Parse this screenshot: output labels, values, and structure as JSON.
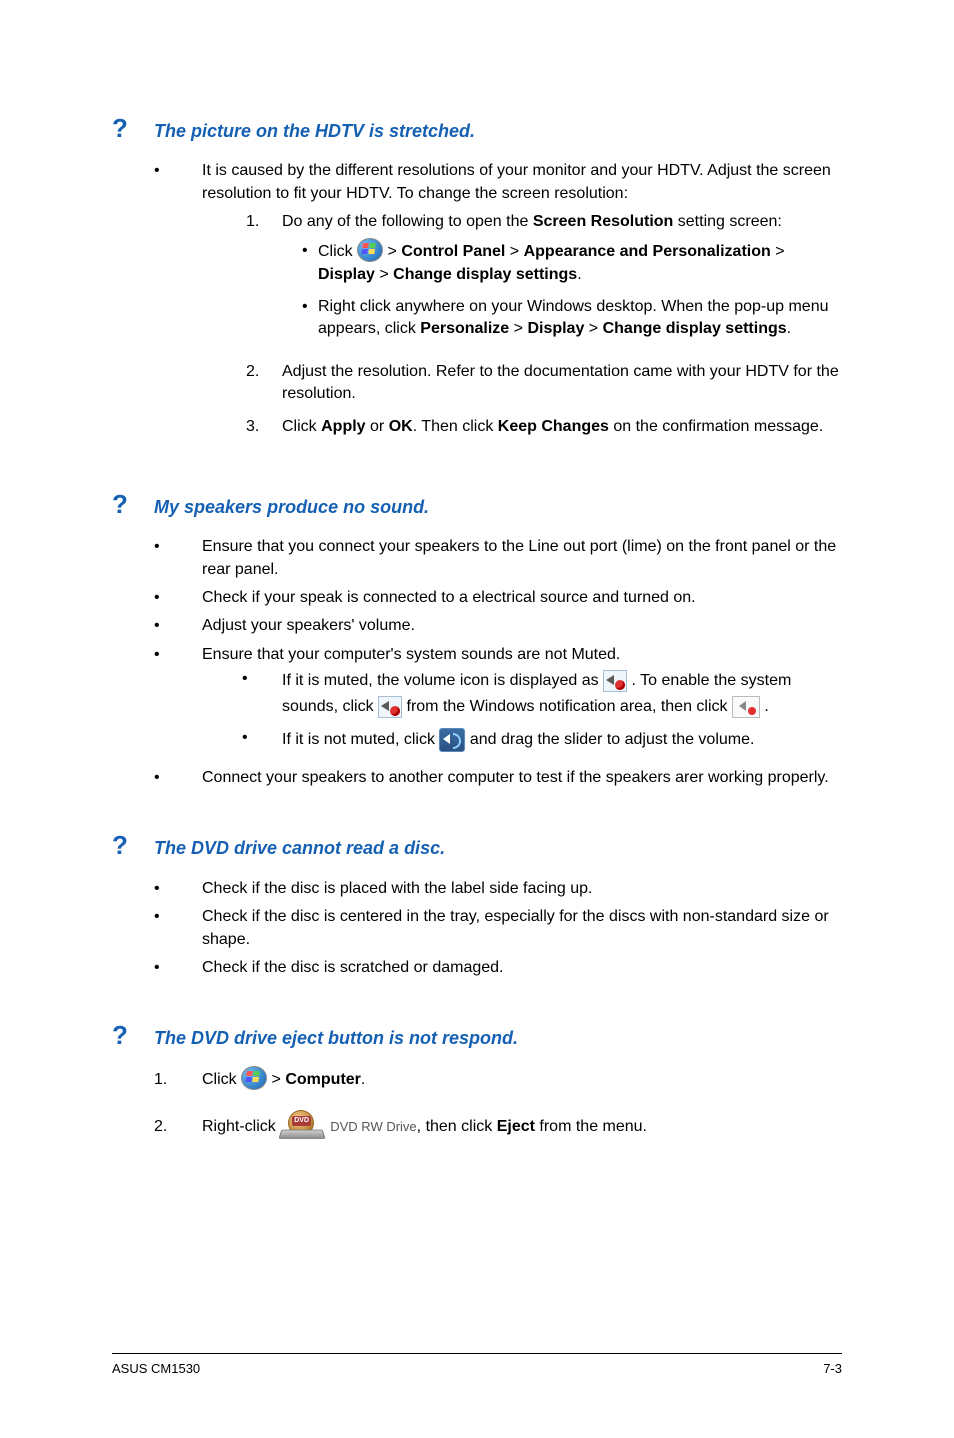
{
  "q1": {
    "title": "The picture on the HDTV is stretched.",
    "intro": "It is caused by the different resolutions of your monitor and your HDTV. Adjust the screen resolution to fit your HDTV. To change the screen resolution:",
    "step1": "Do any of the following to open the ",
    "step1_bold": "Screen Resolution",
    "step1_after": " setting screen:",
    "sub1_pre": "Click ",
    "sub1_mid": " > ",
    "sub1_cp": "Control Panel",
    "sub1_ap": "Appearance and Personalization",
    "sub1_disp": "Display",
    "sub1_cds": "Change display settings",
    "sub2_a": "Right click anywhere on your Windows desktop. When the pop-up menu appears, click ",
    "sub2_p": "Personalize",
    "sub2_d": "Display",
    "sub2_c": "Change display settings",
    "step2": "Adjust the resolution. Refer to the documentation came with your HDTV for the resolution.",
    "step3_a": "Click ",
    "step3_apply": "Apply",
    "step3_or": " or ",
    "step3_ok": "OK",
    "step3_b": ". Then click ",
    "step3_kc": "Keep Changes",
    "step3_c": " on the confirmation message."
  },
  "q2": {
    "title": "My speakers produce no sound.",
    "b1": "Ensure that you connect your speakers to the Line out port (lime) on the front panel or the rear panel.",
    "b2": "Check if your speak is connected to a electrical source and turned on.",
    "b3": "Adjust your speakers' volume.",
    "b4": "Ensure that your computer's system sounds are not Muted.",
    "b4s1_a": "If it is muted, the volume icon is displayed as ",
    "b4s1_b": " . To enable the system sounds, click ",
    "b4s1_c": " from the Windows notification area, then click ",
    "b4s1_d": " .",
    "b4s2_a": "If it is not muted, click ",
    "b4s2_b": " and drag the slider to adjust the volume.",
    "b5": "Connect your speakers to another computer to test if the speakers arer working properly."
  },
  "q3": {
    "title": "The DVD drive cannot read a disc.",
    "b1": "Check if the disc is placed with the label side facing up.",
    "b2": "Check if the disc is centered in the tray, especially for the discs with non-standard size or shape.",
    "b3": "Check if the disc is scratched or damaged."
  },
  "q4": {
    "title": "The DVD drive eject button is not respond.",
    "s1_a": "Click ",
    "s1_b": " > ",
    "s1_comp": "Computer",
    "s2_a": "Right-click ",
    "s2_drive_text": "DVD RW Drive",
    "s2_b": ", then click ",
    "s2_eject": "Eject",
    "s2_c": " from the menu."
  },
  "footer": {
    "left": "ASUS CM1530",
    "right": "7-3"
  },
  "icons": {
    "dvd_badge": "DVD"
  }
}
